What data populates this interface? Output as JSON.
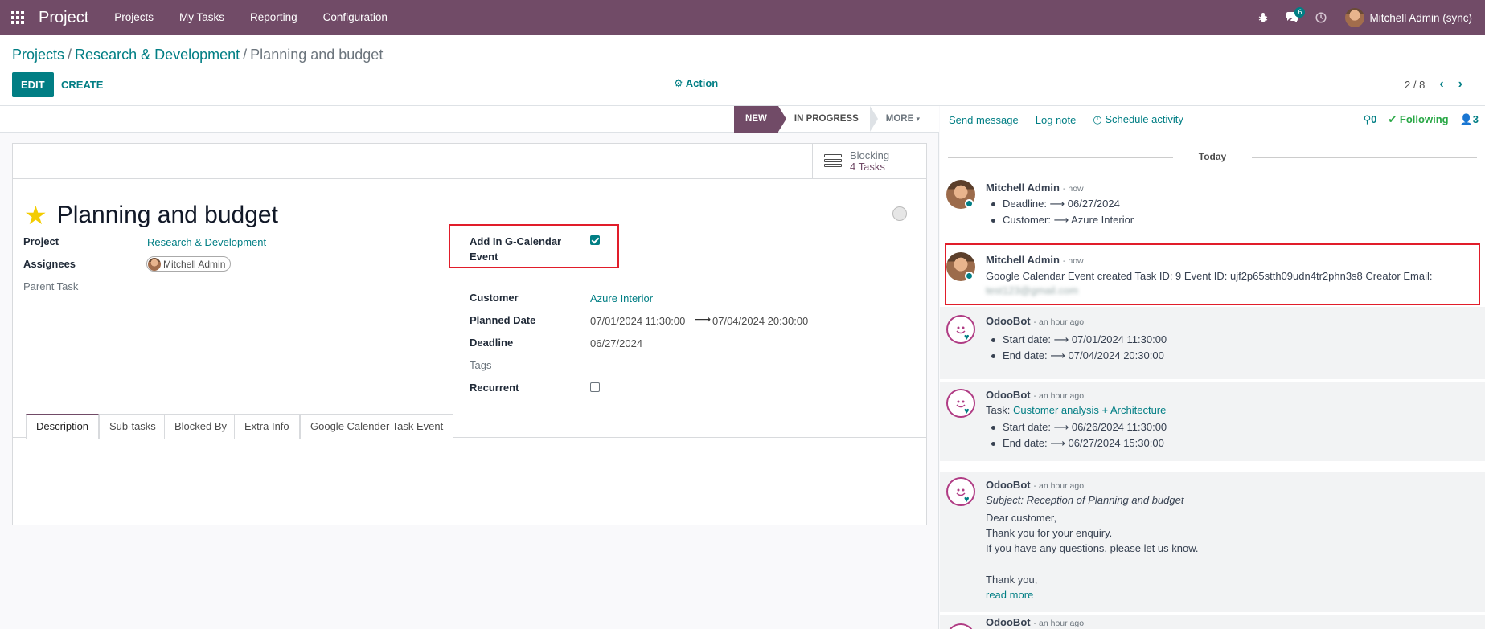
{
  "navbar": {
    "brand": "Project",
    "menu": [
      "Projects",
      "My Tasks",
      "Reporting",
      "Configuration"
    ],
    "messages_count": "6",
    "user_name": "Mitchell Admin (sync)"
  },
  "breadcrumb": {
    "items": [
      "Projects",
      "Research & Development"
    ],
    "current": "Planning and budget"
  },
  "toolbar": {
    "edit_label": "EDIT",
    "create_label": "CREATE",
    "action_label": "Action",
    "pager": "2 / 8"
  },
  "statusbar": {
    "stages": [
      "NEW",
      "IN PROGRESS",
      "MORE"
    ],
    "active_stage": "NEW"
  },
  "smart_button": {
    "line1": "Blocking",
    "line2": "4 Tasks"
  },
  "task": {
    "title": "Planning and budget",
    "starred": true,
    "fields_left": {
      "project_label": "Project",
      "project_value": "Research & Development",
      "assignees_label": "Assignees",
      "assignee": "Mitchell Admin",
      "parent_label": "Parent Task"
    },
    "fields_right": {
      "gcal_label_1": "Add In G-Calendar",
      "gcal_label_2": "Event",
      "gcal_checked": true,
      "customer_label": "Customer",
      "customer_value": "Azure Interior",
      "planned_label": "Planned Date",
      "planned_start": "07/01/2024 11:30:00",
      "planned_end": "07/04/2024 20:30:00",
      "deadline_label": "Deadline",
      "deadline_value": "06/27/2024",
      "tags_label": "Tags",
      "recurrent_label": "Recurrent",
      "recurrent_checked": false
    },
    "tabs": [
      "Description",
      "Sub-tasks",
      "Blocked By",
      "Extra Info",
      "Google Calender Task Event"
    ]
  },
  "chatter": {
    "send_message": "Send message",
    "log_note": "Log note",
    "schedule_activity": "Schedule activity",
    "attachments": "0",
    "following": "Following",
    "followers": "3",
    "today_label": "Today",
    "messages": [
      {
        "author": "Mitchell Admin",
        "time": "- now",
        "bullets": [
          "Deadline: ⟶ 06/27/2024",
          "Customer: ⟶ Azure Interior"
        ]
      },
      {
        "author": "Mitchell Admin",
        "time": "- now",
        "text": "Google Calendar Event created Task ID: 9 Event ID: ujf2p65stth09udn4tr2phn3s8 Creator Email:",
        "text2": "test123@gmail.com"
      },
      {
        "author": "OdooBot",
        "time": "- an hour ago",
        "bullets": [
          "Start date: ⟶ 07/01/2024 11:30:00",
          "End date: ⟶ 07/04/2024 20:30:00"
        ]
      },
      {
        "author": "OdooBot",
        "time": "- an hour ago",
        "task_prefix": "Task:",
        "task_link": "Customer analysis + Architecture",
        "bullets": [
          "Start date: ⟶ 06/26/2024 11:30:00",
          "End date: ⟶ 06/27/2024 15:30:00"
        ]
      },
      {
        "author": "OdooBot",
        "time": "- an hour ago",
        "subject": "Subject: Reception of Planning and budget",
        "lines": [
          "Dear customer,",
          "Thank you for your enquiry.",
          "If you have any questions, please let us know.",
          "",
          "Thank you,"
        ],
        "read_more": "read more"
      },
      {
        "author": "OdooBot",
        "time": "- an hour ago"
      }
    ]
  },
  "colors": {
    "brand": "#714b67",
    "accent": "#017e84",
    "highlight": "#e11d2a"
  }
}
